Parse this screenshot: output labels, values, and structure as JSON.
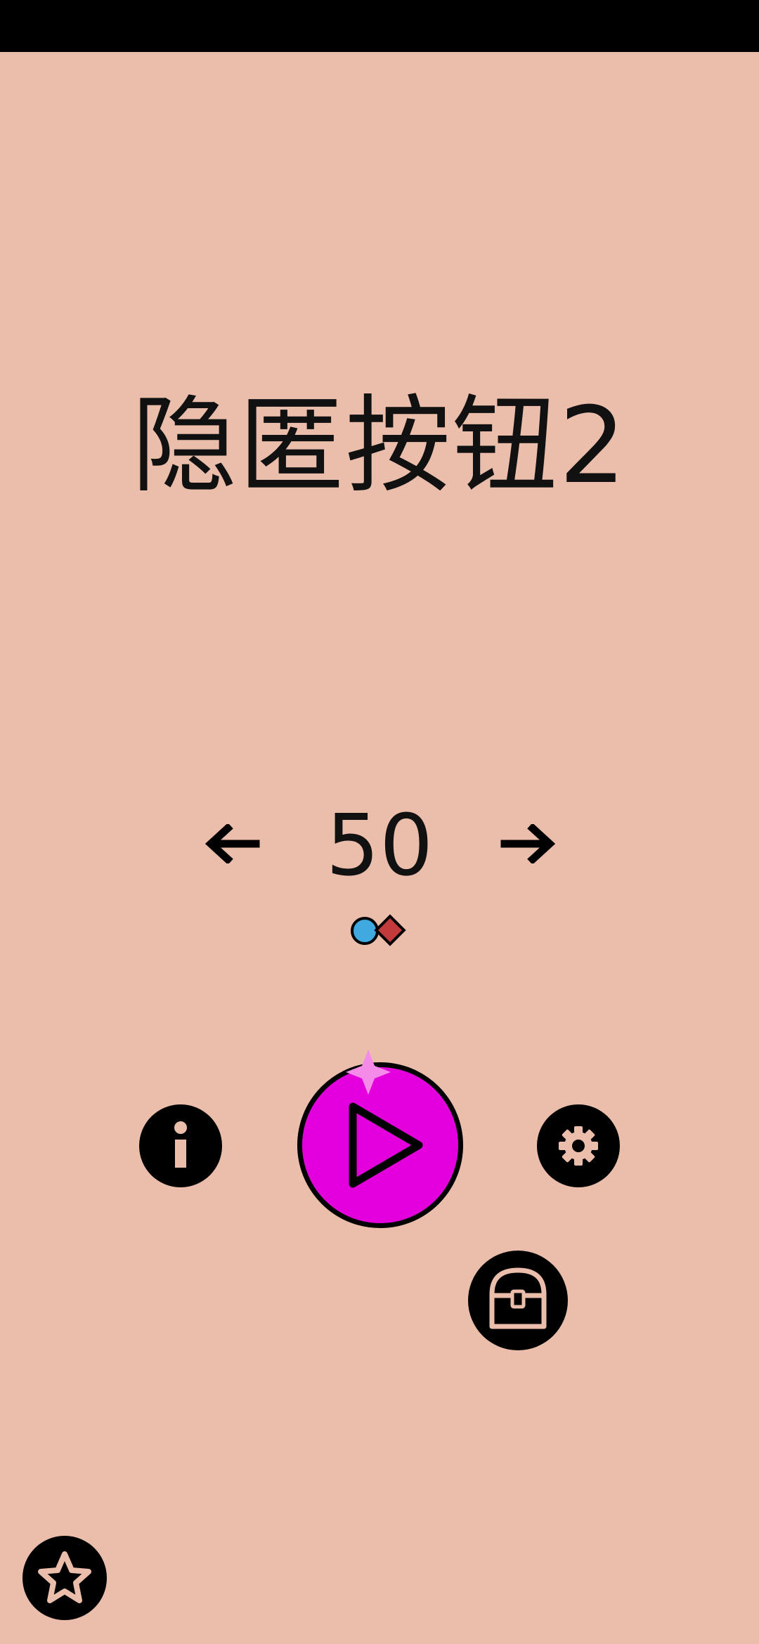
{
  "screen": {
    "background_color": "#EBBDAB",
    "status_bar_color": "#000000"
  },
  "title": {
    "text": "隐匿按钮2"
  },
  "level_selector": {
    "level": "50",
    "prev_icon": "arrow-left-icon",
    "next_icon": "arrow-right-icon"
  },
  "collectibles": {
    "icons": [
      "blue-circle-icon",
      "red-diamond-icon"
    ],
    "colors": {
      "circle": "#3FA9E0",
      "diamond": "#C23A3A"
    }
  },
  "buttons": {
    "info": {
      "icon": "info-icon"
    },
    "play": {
      "icon": "play-icon",
      "color": "#E400DD",
      "sparkle_color": "#F58BE8"
    },
    "settings": {
      "icon": "gear-icon"
    },
    "chest": {
      "icon": "treasure-chest-icon"
    },
    "rate": {
      "icon": "star-icon"
    }
  }
}
